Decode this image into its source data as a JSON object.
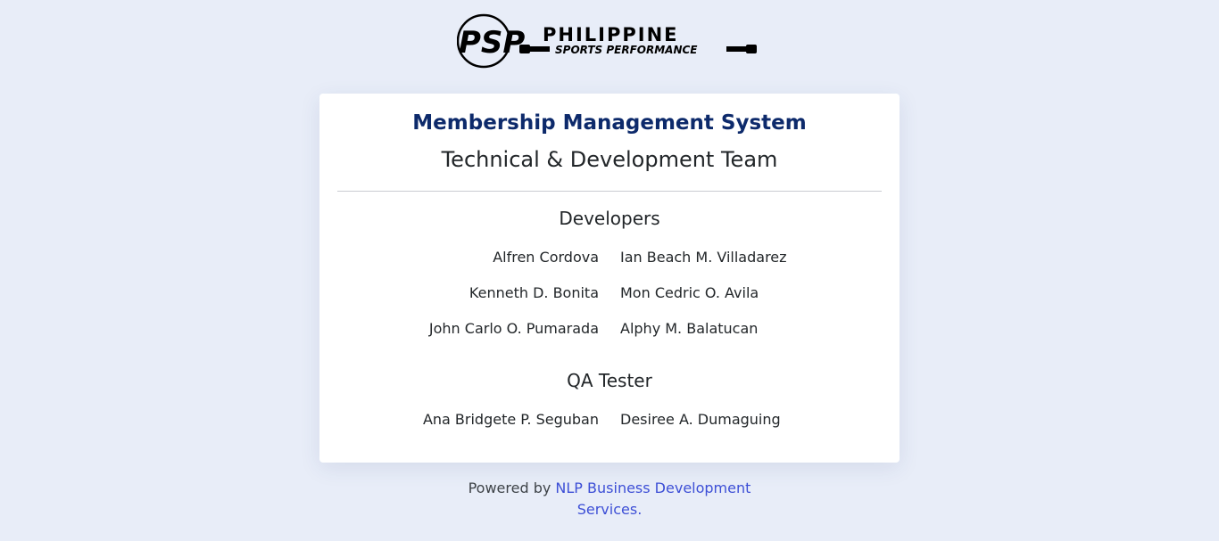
{
  "logo": {
    "text_line1": "PHILIPPINE",
    "text_line2": "SPORTS PERFORMANCE",
    "mark": "PSP"
  },
  "card": {
    "system_title": "Membership Management System",
    "team_title": "Technical & Development Team",
    "developers": {
      "heading": "Developers",
      "rows": [
        {
          "left": "Alfren Cordova",
          "right": "Ian Beach M. Villadarez"
        },
        {
          "left": "Kenneth D. Bonita",
          "right": "Mon Cedric O. Avila"
        },
        {
          "left": "John Carlo O. Pumarada",
          "right": "Alphy M. Balatucan"
        }
      ]
    },
    "qa": {
      "heading": "QA Tester",
      "rows": [
        {
          "left": "Ana Bridgete P. Seguban",
          "right": "Desiree A. Dumaguing"
        }
      ]
    }
  },
  "footer": {
    "prefix": "Powered by ",
    "link_text": "NLP Business Development Services."
  },
  "colors": {
    "background": "#e8edf8",
    "title_navy": "#0d2a6b",
    "link_blue": "#3d4fd6"
  }
}
